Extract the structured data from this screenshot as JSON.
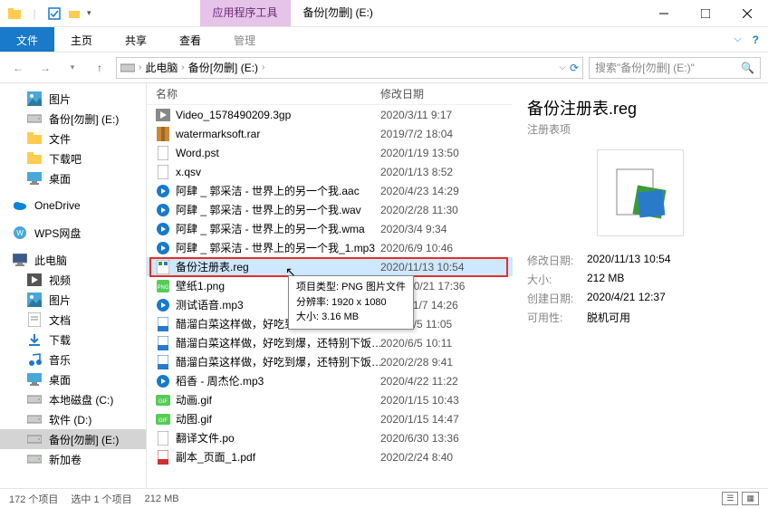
{
  "window": {
    "context_tab": "应用程序工具",
    "title": "备份[勿删] (E:)"
  },
  "ribbon": {
    "file": "文件",
    "home": "主页",
    "share": "共享",
    "view": "查看",
    "manage": "管理"
  },
  "address": {
    "this_pc": "此电脑",
    "location": "备份[勿删] (E:)"
  },
  "search": {
    "placeholder": "搜索\"备份[勿删] (E:)\""
  },
  "sidebar": {
    "items": [
      {
        "label": "图片",
        "icon": "pictures"
      },
      {
        "label": "备份[勿删] (E:)",
        "icon": "drive"
      },
      {
        "label": "文件",
        "icon": "folder"
      },
      {
        "label": "下载吧",
        "icon": "folder"
      },
      {
        "label": "桌面",
        "icon": "desktop"
      },
      {
        "label": "OneDrive",
        "icon": "onedrive"
      },
      {
        "label": "WPS网盘",
        "icon": "wps"
      },
      {
        "label": "此电脑",
        "icon": "thispc"
      },
      {
        "label": "视频",
        "icon": "videos"
      },
      {
        "label": "图片",
        "icon": "pictures"
      },
      {
        "label": "文档",
        "icon": "documents"
      },
      {
        "label": "下载",
        "icon": "downloads"
      },
      {
        "label": "音乐",
        "icon": "music"
      },
      {
        "label": "桌面",
        "icon": "desktop"
      },
      {
        "label": "本地磁盘 (C:)",
        "icon": "drive"
      },
      {
        "label": "软件 (D:)",
        "icon": "drive"
      },
      {
        "label": "备份[勿删] (E:)",
        "icon": "drive"
      },
      {
        "label": "新加卷",
        "icon": "drive"
      }
    ]
  },
  "columns": {
    "name": "名称",
    "date": "修改日期"
  },
  "files": [
    {
      "name": "Video_1578490209.3gp",
      "date": "2020/3/11 9:17",
      "icon": "video"
    },
    {
      "name": "watermarksoft.rar",
      "date": "2019/7/2 18:04",
      "icon": "archive"
    },
    {
      "name": "Word.pst",
      "date": "2020/1/19 13:50",
      "icon": "file"
    },
    {
      "name": "x.qsv",
      "date": "2020/1/13 8:52",
      "icon": "file"
    },
    {
      "name": "阿肆 _ 郭采洁 - 世界上的另一个我.aac",
      "date": "2020/4/23 14:29",
      "icon": "audio"
    },
    {
      "name": "阿肆 _ 郭采洁 - 世界上的另一个我.wav",
      "date": "2020/2/28 11:30",
      "icon": "audio"
    },
    {
      "name": "阿肆 _ 郭采洁 - 世界上的另一个我.wma",
      "date": "2020/3/4 9:34",
      "icon": "audio"
    },
    {
      "name": "阿肆 _ 郭采洁 - 世界上的另一个我_1.mp3",
      "date": "2020/6/9 10:46",
      "icon": "audio"
    },
    {
      "name": "备份注册表.reg",
      "date": "2020/11/13 10:54",
      "icon": "reg",
      "selected": true
    },
    {
      "name": "壁纸1.png",
      "date": "2020/10/21 17:36",
      "icon": "image"
    },
    {
      "name": "测试语音.mp3",
      "date": "2020/11/7 14:26",
      "icon": "audio"
    },
    {
      "name": "醋溜白菜这样做，好吃到…",
      "date": "2020/6/5 11:05",
      "icon": "doc"
    },
    {
      "name": "醋溜白菜这样做，好吃到爆，还特别下饭…",
      "date": "2020/6/5 10:11",
      "icon": "doc"
    },
    {
      "name": "醋溜白菜这样做，好吃到爆，还特别下饭…",
      "date": "2020/2/28 9:41",
      "icon": "doc"
    },
    {
      "name": "稻香 - 周杰伦.mp3",
      "date": "2020/4/22 11:22",
      "icon": "audio"
    },
    {
      "name": "动画.gif",
      "date": "2020/1/15 10:43",
      "icon": "gif"
    },
    {
      "name": "动图.gif",
      "date": "2020/1/15 14:47",
      "icon": "gif"
    },
    {
      "name": "翻译文件.po",
      "date": "2020/6/30 13:36",
      "icon": "file"
    },
    {
      "name": "副本_页面_1.pdf",
      "date": "2020/2/24 8:40",
      "icon": "pdf"
    }
  ],
  "tooltip": {
    "line1": "项目类型: PNG 图片文件",
    "line2": "分辨率: 1920 x 1080",
    "line3": "大小: 3.16 MB"
  },
  "details": {
    "title": "备份注册表.reg",
    "subtitle": "注册表项",
    "props": [
      {
        "label": "修改日期:",
        "value": "2020/11/13 10:54"
      },
      {
        "label": "大小:",
        "value": "212 MB"
      },
      {
        "label": "创建日期:",
        "value": "2020/4/21 12:37"
      },
      {
        "label": "可用性:",
        "value": "脱机可用"
      }
    ]
  },
  "status": {
    "count": "172 个项目",
    "selected": "选中 1 个项目",
    "size": "212 MB"
  }
}
